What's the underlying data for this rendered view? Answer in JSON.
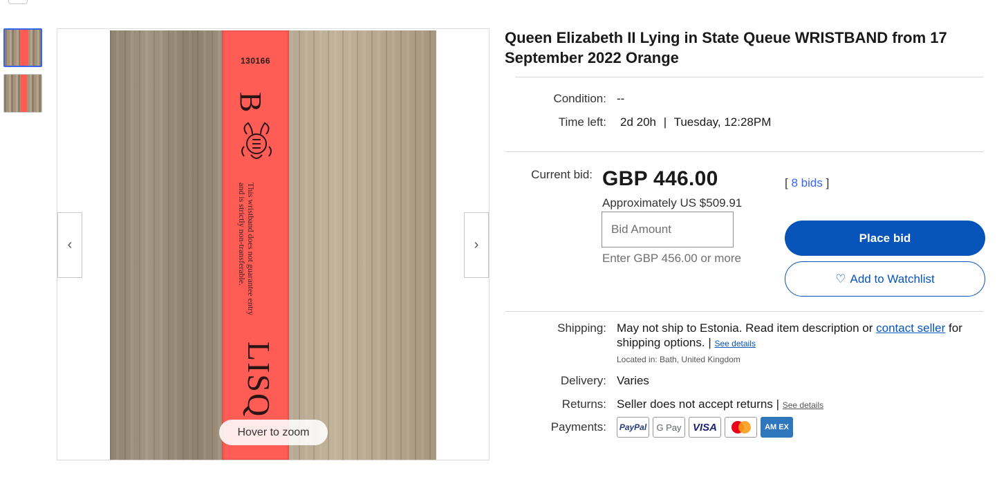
{
  "gallery": {
    "thumbnails": [
      "thumbnail-1",
      "thumbnail-2"
    ],
    "prev_icon": "‹",
    "next_icon": "›",
    "zoom_hint": "Hover to zoom",
    "photo_text": {
      "number": "130166",
      "letter": "B",
      "notice_line1": "This wristband does not guarantee entry",
      "notice_line2": "and is strictly non-transferable.",
      "word": "LISQ"
    }
  },
  "listing": {
    "title": "Queen Elizabeth II Lying in State Queue WRISTBAND from 17 September 2022 Orange",
    "condition_label": "Condition:",
    "condition_value": "--",
    "time_left_label": "Time left:",
    "time_left_value": "2d 20h",
    "time_left_separator": "|",
    "end_time": "Tuesday, 12:28PM"
  },
  "bidding": {
    "current_bid_label": "Current bid:",
    "price": "GBP 446.00",
    "approx_prefix": "Approximately",
    "approx_value": "US $509.91",
    "bids_open": "[",
    "bids_link": "8 bids",
    "bids_close": "]",
    "bid_placeholder": "Bid Amount",
    "min_bid_text": "Enter GBP 456.00 or more",
    "place_bid_label": "Place bid",
    "watchlist_label": "Add to Watchlist",
    "watchlist_icon": "♡"
  },
  "details": {
    "shipping_label": "Shipping:",
    "shipping_text_1": "May not ship to Estonia. Read item description or",
    "contact_seller": "contact seller",
    "shipping_text_2": "for shipping options.",
    "shipping_sep": "|",
    "see_details": "See details",
    "located": "Located in: Bath, United Kingdom",
    "delivery_label": "Delivery:",
    "delivery_value": "Varies",
    "returns_label": "Returns:",
    "returns_value": "Seller does not accept returns",
    "returns_sep": "|",
    "returns_see_details": "See details",
    "payments_label": "Payments:",
    "payments": [
      "PayPal",
      "G Pay",
      "VISA",
      "",
      "AM EX"
    ]
  },
  "colors": {
    "primary_blue": "#0654ba",
    "link_blue": "#3665f3",
    "wristband": "#ff5c55",
    "mastercard_red": "#eb001b",
    "mastercard_orange": "#f79e1b"
  }
}
